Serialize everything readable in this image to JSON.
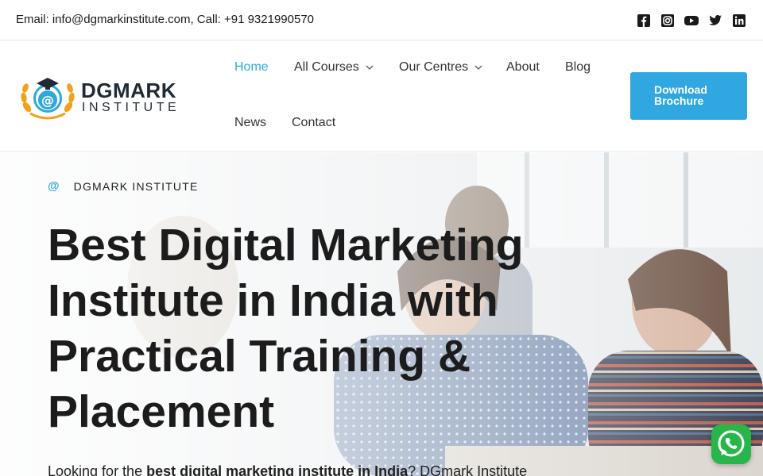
{
  "topbar": {
    "contact_text": "Email: info@dgmarkinstitute.com, Call: +91 9321990570",
    "socials": [
      "facebook-icon",
      "instagram-icon",
      "youtube-icon",
      "twitter-icon",
      "linkedin-icon"
    ]
  },
  "logo": {
    "word1": "DGMARK",
    "word2": "INSTITUTE"
  },
  "nav": {
    "home": "Home",
    "all_courses": "All Courses",
    "our_centres": "Our Centres",
    "about": "About",
    "blog": "Blog",
    "news": "News",
    "contact": "Contact"
  },
  "cta": {
    "label": "Download Brochure"
  },
  "hero": {
    "eyebrow_symbol": "@",
    "eyebrow_text": "DGMARK INSTITUTE",
    "title": "Best Digital Marketing Institute in India with Practical Training & Placement",
    "lead_start": "Looking for the ",
    "lead_bold": "best digital marketing institute in India",
    "lead_end": "? DGmark Institute"
  },
  "colors": {
    "accent": "#2ea8dd",
    "cta_bg": "#30a7e0",
    "whatsapp": "#28b54a"
  }
}
